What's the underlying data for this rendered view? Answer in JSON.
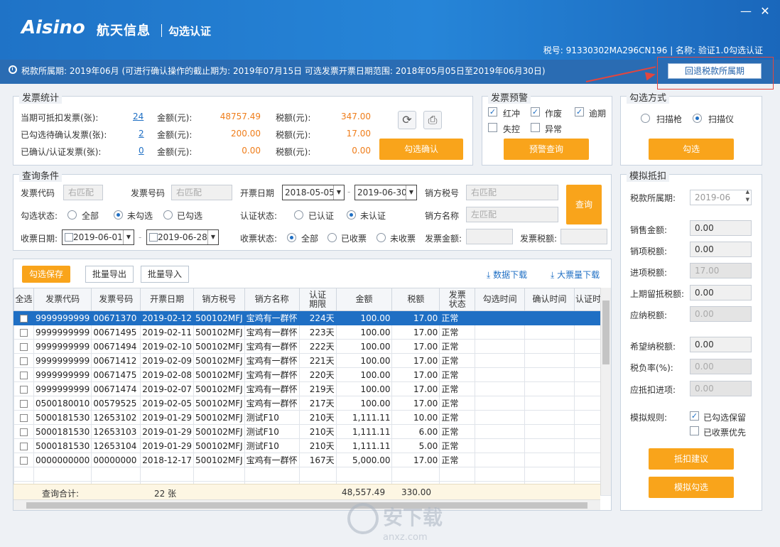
{
  "header": {
    "brand": "Aisino",
    "brand_cn": "航天信息",
    "module": "勾选认证",
    "taxinfo": "税号: 91330302MA296CN196 | 名称: 验证1.0勾选认证",
    "minimize": "—",
    "close": "✕"
  },
  "period": {
    "text": "税款所属期: 2019年06月 (可进行确认操作的截止期为: 2019年07月15日 可选发票开票日期范围: 2018年05月05日至2019年06月30日)",
    "back_button": "回退税款所属期"
  },
  "stats": {
    "title": "发票统计",
    "rows": [
      {
        "label": "当期可抵扣发票(张):",
        "count": "24",
        "amount_label": "金额(元):",
        "amount": "48757.49",
        "tax_label": "税额(元):",
        "tax": "347.00"
      },
      {
        "label": "已勾选待确认发票(张):",
        "count": "2",
        "amount_label": "金额(元):",
        "amount": "200.00",
        "tax_label": "税额(元):",
        "tax": "17.00"
      },
      {
        "label": "已确认/认证发票(张):",
        "count": "0",
        "amount_label": "金额(元):",
        "amount": "0.00",
        "tax_label": "税额(元):",
        "tax": "0.00"
      }
    ],
    "confirm_button": "勾选确认"
  },
  "warning": {
    "title": "发票预警",
    "items": [
      {
        "label": "红冲",
        "checked": true
      },
      {
        "label": "作废",
        "checked": true
      },
      {
        "label": "逾期",
        "checked": true
      },
      {
        "label": "失控",
        "checked": false
      },
      {
        "label": "异常",
        "checked": false
      }
    ],
    "query_button": "预警查询"
  },
  "select_mode": {
    "title": "勾选方式",
    "opt1": "扫描枪",
    "opt2": "扫描仪",
    "selected": "扫描仪",
    "button": "勾选"
  },
  "query": {
    "title": "查询条件",
    "code_label": "发票代码",
    "code_ph": "右匹配",
    "number_label": "发票号码",
    "number_ph": "右匹配",
    "date_label": "开票日期",
    "date_from": "2018-05-05",
    "date_to": "2019-06-30",
    "seller_tax_label": "销方税号",
    "seller_tax_ph": "右匹配",
    "check_status_label": "勾选状态:",
    "check_all": "全部",
    "check_unselected": "未勾选",
    "check_selected": "已勾选",
    "cert_status_label": "认证状态:",
    "cert_yes": "已认证",
    "cert_no": "未认证",
    "seller_name_label": "销方名称",
    "seller_name_ph": "左匹配",
    "recv_date_label": "收票日期:",
    "recv_from": "2019-06-01",
    "recv_to": "2019-06-28",
    "recv_status_label": "收票状态:",
    "recv_all": "全部",
    "recv_yes": "已收票",
    "recv_no": "未收票",
    "inv_amount_label": "发票金额:",
    "inv_tax_label": "发票税额:",
    "query_button": "查询"
  },
  "toolbar": {
    "save": "勾选保存",
    "export": "批量导出",
    "import": "批量导入",
    "download": "数据下载",
    "bulk_download": "大票量下载"
  },
  "table": {
    "headers": [
      "全选",
      "发票代码",
      "发票号码",
      "开票日期",
      "销方税号",
      "销方名称",
      "认证期限",
      "金额",
      "税额",
      "发票状态",
      "勾选时间",
      "确认时间",
      "认证时间"
    ],
    "rows": [
      [
        "9999999999",
        "00671370",
        "2019-02-12",
        "500102MFJ",
        "宝鸡有一群怀",
        "224天",
        "100.00",
        "17.00",
        "正常"
      ],
      [
        "9999999999",
        "00671495",
        "2019-02-11",
        "500102MFJ",
        "宝鸡有一群怀",
        "223天",
        "100.00",
        "17.00",
        "正常"
      ],
      [
        "9999999999",
        "00671494",
        "2019-02-10",
        "500102MFJ",
        "宝鸡有一群怀",
        "222天",
        "100.00",
        "17.00",
        "正常"
      ],
      [
        "9999999999",
        "00671412",
        "2019-02-09",
        "500102MFJ",
        "宝鸡有一群怀",
        "221天",
        "100.00",
        "17.00",
        "正常"
      ],
      [
        "9999999999",
        "00671475",
        "2019-02-08",
        "500102MFJ",
        "宝鸡有一群怀",
        "220天",
        "100.00",
        "17.00",
        "正常"
      ],
      [
        "9999999999",
        "00671474",
        "2019-02-07",
        "500102MFJ",
        "宝鸡有一群怀",
        "219天",
        "100.00",
        "17.00",
        "正常"
      ],
      [
        "0500180010",
        "00579525",
        "2019-02-05",
        "500102MFJ",
        "宝鸡有一群怀",
        "217天",
        "100.00",
        "17.00",
        "正常"
      ],
      [
        "5000181530",
        "12653102",
        "2019-01-29",
        "500102MFJ",
        "测试F10",
        "210天",
        "1,111.11",
        "10.00",
        "正常"
      ],
      [
        "5000181530",
        "12653103",
        "2019-01-29",
        "500102MFJ",
        "测试F10",
        "210天",
        "1,111.11",
        "6.00",
        "正常"
      ],
      [
        "5000181530",
        "12653104",
        "2019-01-29",
        "500102MFJ",
        "测试F10",
        "210天",
        "1,111.11",
        "5.00",
        "正常"
      ],
      [
        "0000000000",
        "00000000",
        "2018-12-17",
        "500102MFJ",
        "宝鸡有一群怀",
        "167天",
        "5,000.00",
        "17.00",
        "正常"
      ]
    ],
    "sum_label": "查询合计:",
    "sum_count": "22 张",
    "sum_amount": "48,557.49",
    "sum_tax": "330.00"
  },
  "sim": {
    "title": "模拟抵扣",
    "period_label": "税款所属期:",
    "period_value": "2019-06",
    "sales_label": "销售金额:",
    "sales_value": "0.00",
    "output_label": "销项税额:",
    "output_value": "0.00",
    "input_label": "进项税额:",
    "input_value": "17.00",
    "prev_label": "上期留抵税额:",
    "prev_value": "0.00",
    "payable_label": "应纳税额:",
    "payable_value": "0.00",
    "hope_label": "希望纳税额:",
    "hope_value": "0.00",
    "burden_label": "税负率(%):",
    "burden_value": "0.00",
    "deduct_label": "应抵扣进项:",
    "deduct_value": "0.00",
    "rule_label": "模拟规则:",
    "rule1": "已勾选保留",
    "rule1_checked": true,
    "rule2": "已收票优先",
    "rule2_checked": false,
    "suggest_button": "抵扣建议",
    "sim_button": "模拟勾选"
  },
  "watermark": {
    "text": "安下载",
    "sub": "anxz.com"
  }
}
